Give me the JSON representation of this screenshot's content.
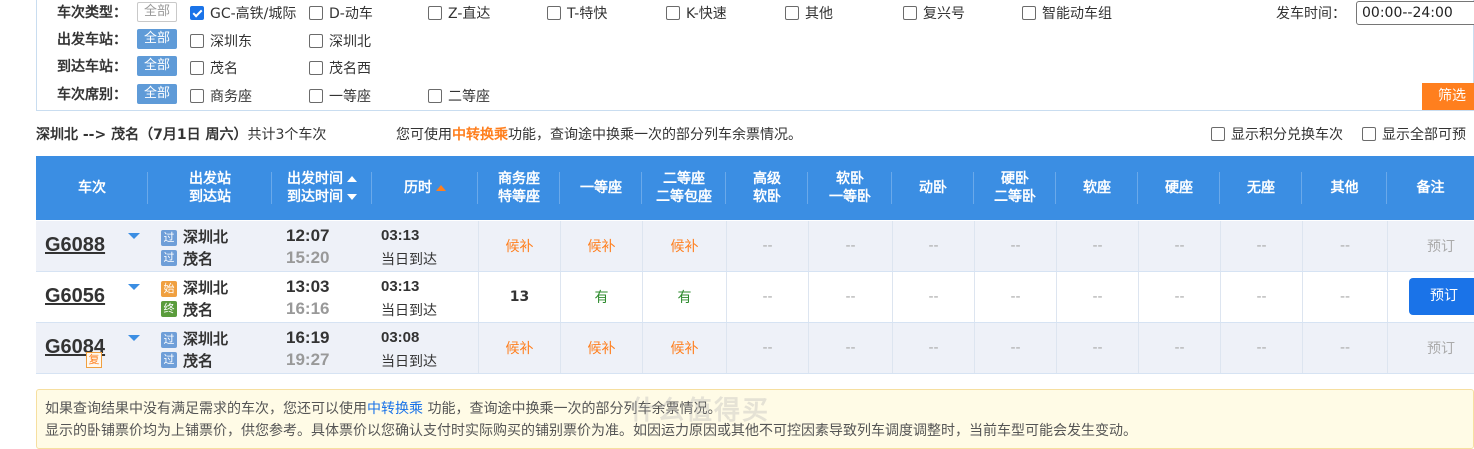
{
  "filters": {
    "train_type": {
      "label": "车次类型：",
      "all": "全部",
      "options": [
        {
          "label": "GC-高铁/城际",
          "checked": true
        },
        {
          "label": "D-动车",
          "checked": false
        },
        {
          "label": "Z-直达",
          "checked": false
        },
        {
          "label": "T-特快",
          "checked": false
        },
        {
          "label": "K-快速",
          "checked": false
        },
        {
          "label": "其他",
          "checked": false
        },
        {
          "label": "复兴号",
          "checked": false
        },
        {
          "label": "智能动车组",
          "checked": false
        }
      ]
    },
    "depart_station": {
      "label": "出发车站：",
      "all": "全部",
      "options": [
        {
          "label": "深圳东"
        },
        {
          "label": "深圳北"
        }
      ]
    },
    "arrive_station": {
      "label": "到达车站：",
      "all": "全部",
      "options": [
        {
          "label": "茂名"
        },
        {
          "label": "茂名西"
        }
      ]
    },
    "seat_type": {
      "label": "车次席别：",
      "all": "全部",
      "options": [
        {
          "label": "商务座"
        },
        {
          "label": "一等座"
        },
        {
          "label": "二等座"
        }
      ]
    },
    "depart_time": {
      "label": "发车时间：",
      "value": "00:00--24:00"
    },
    "filter_button": "筛选"
  },
  "summary": {
    "route": "深圳北 --> 茂名（7月1日  周六）",
    "count": "共计3个车次",
    "tip_prefix": "您可使用",
    "tip_link": "中转换乘",
    "tip_suffix": "功能，查询途中换乘一次的部分列车余票情况。",
    "option_points": "显示积分兑换车次",
    "option_all": "显示全部可预"
  },
  "table": {
    "headers": {
      "train": "车次",
      "station_top": "出发站",
      "station_bottom": "到达站",
      "time_top": "出发时间",
      "time_bottom": "到达时间",
      "duration": "历时",
      "business_top": "商务座",
      "business_bottom": "特等座",
      "first": "一等座",
      "second_top": "二等座",
      "second_bottom": "二等包座",
      "adv_top": "高级",
      "adv_bottom": "软卧",
      "soft_top": "软卧",
      "soft_bottom": "一等卧",
      "dongwo": "动卧",
      "hard_top": "硬卧",
      "hard_bottom": "二等卧",
      "softseat": "软座",
      "hardseat": "硬座",
      "noseat": "无座",
      "other": "其他",
      "remark": "备注"
    },
    "rows": [
      {
        "train": "G6088",
        "badge": "",
        "from_tag": "过",
        "from": "深圳北",
        "to_tag": "过",
        "to": "茂名",
        "depart": "12:07",
        "arrive": "15:20",
        "duration": "03:13",
        "duration_note": "当日到达",
        "business": "候补",
        "first": "候补",
        "second": "候补",
        "adv": "--",
        "soft": "--",
        "dongwo": "--",
        "hard": "--",
        "softseat": "--",
        "hardseat": "--",
        "noseat": "--",
        "other": "--",
        "remark": "预订",
        "bookable": false
      },
      {
        "train": "G6056",
        "badge": "",
        "from_tag": "始",
        "from": "深圳北",
        "to_tag": "终",
        "to": "茂名",
        "depart": "13:03",
        "arrive": "16:16",
        "duration": "03:13",
        "duration_note": "当日到达",
        "business": "13",
        "first": "有",
        "second": "有",
        "adv": "--",
        "soft": "--",
        "dongwo": "--",
        "hard": "--",
        "softseat": "--",
        "hardseat": "--",
        "noseat": "--",
        "other": "--",
        "remark": "预订",
        "bookable": true
      },
      {
        "train": "G6084",
        "badge": "复",
        "from_tag": "过",
        "from": "深圳北",
        "to_tag": "过",
        "to": "茂名",
        "depart": "16:19",
        "arrive": "19:27",
        "duration": "03:08",
        "duration_note": "当日到达",
        "business": "候补",
        "first": "候补",
        "second": "候补",
        "adv": "--",
        "soft": "--",
        "dongwo": "--",
        "hard": "--",
        "softseat": "--",
        "hardseat": "--",
        "noseat": "--",
        "other": "--",
        "remark": "预订",
        "bookable": false
      }
    ]
  },
  "notice": {
    "line1_prefix": "如果查询结果中没有满足需求的车次，您还可以使用",
    "line1_link": "中转换乘",
    "line1_suffix": " 功能，查询途中换乘一次的部分列车余票情况。",
    "line2": "显示的卧铺票价均为上铺票价，供您参考。具体票价以您确认支付时实际购买的铺别票价为准。如因运力原因或其他不可控因素导致列车调度调整时，当前车型可能会发生变动。"
  },
  "watermark": "什么值得买"
}
